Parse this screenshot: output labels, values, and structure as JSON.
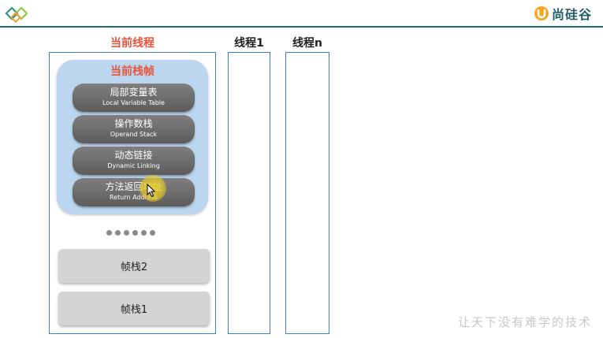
{
  "header": {
    "brand_text": "尚硅谷",
    "accent_color": "#1f6f7a",
    "brand_icon": "u-logo-icon",
    "logo_icon": "diamonds-logo-icon"
  },
  "columns": {
    "current_thread": "当前线程",
    "thread1": "线程1",
    "threadn": "线程n"
  },
  "current_frame": {
    "title": "当前栈帧",
    "items": [
      {
        "zh": "局部变量表",
        "en": "Local Variable Table"
      },
      {
        "zh": "操作数栈",
        "en": "Operand Stack"
      },
      {
        "zh": "动态链接",
        "en": "Dynamic Linking"
      },
      {
        "zh": "方法返回地址",
        "en": "Return Address"
      }
    ]
  },
  "stack_frames": [
    "帧栈2",
    "帧栈1"
  ],
  "footer": {
    "slogan": "让天下没有难学的技术"
  },
  "colors": {
    "title_red": "#e8543a",
    "frame_blue": "#bcd6f0",
    "pill_gray": "#6e6e6e",
    "thread_border": "#3d7fc1"
  }
}
